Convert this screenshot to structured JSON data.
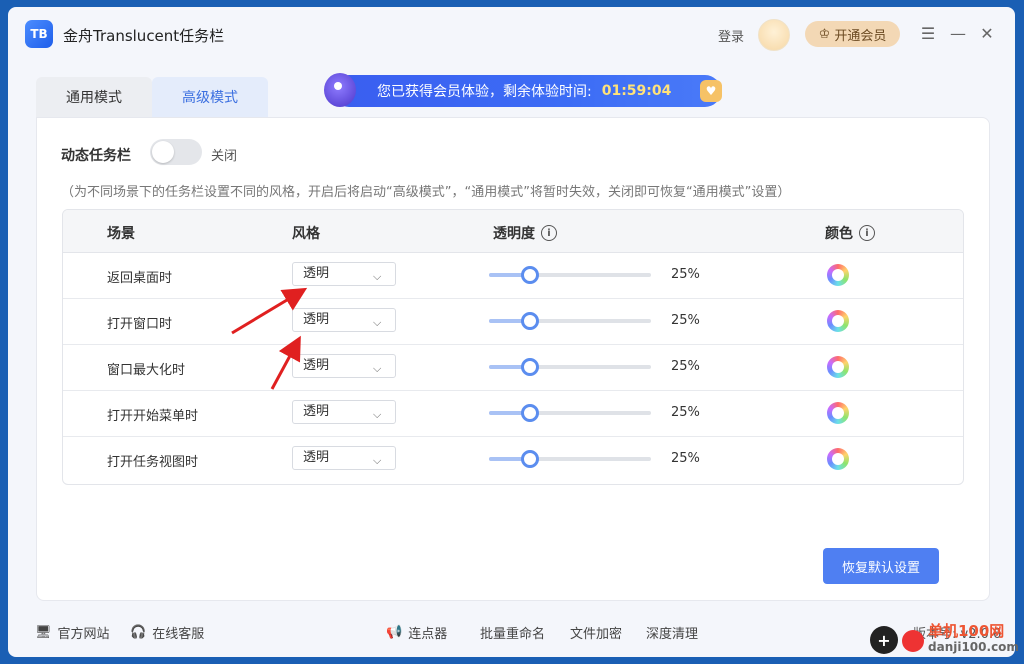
{
  "app": {
    "logo_text": "TB",
    "title": "金舟Translucent任务栏"
  },
  "header": {
    "login_label": "登录",
    "vip_label": "开通会员",
    "vip_icon": "crown-icon"
  },
  "window_controls": {
    "menu": "☰",
    "minimize": "—",
    "close": "✕"
  },
  "tabs": [
    {
      "label": "通用模式"
    },
    {
      "label": "高级模式"
    }
  ],
  "promo": {
    "text": "您已获得会员体验，剩余体验时间:",
    "time": "01:59:04",
    "gift_icon": "gift-icon"
  },
  "dynamic_taskbar": {
    "label": "动态任务栏",
    "state": "关闭"
  },
  "description": "（为不同场景下的任务栏设置不同的风格，开启后将启动“高级模式”，“通用模式”将暂时失效，关闭即可恢复“通用模式”设置）",
  "table": {
    "headers": {
      "scene": "场景",
      "style": "风格",
      "opacity": "透明度",
      "color": "颜色"
    },
    "rows": [
      {
        "scene": "返回桌面时",
        "style": "透明",
        "opacity_value": 25,
        "opacity_label": "25%"
      },
      {
        "scene": "打开窗口时",
        "style": "透明",
        "opacity_value": 25,
        "opacity_label": "25%"
      },
      {
        "scene": "窗口最大化时",
        "style": "透明",
        "opacity_value": 25,
        "opacity_label": "25%"
      },
      {
        "scene": "打开开始菜单时",
        "style": "透明",
        "opacity_value": 25,
        "opacity_label": "25%"
      },
      {
        "scene": "打开任务视图时",
        "style": "透明",
        "opacity_value": 25,
        "opacity_label": "25%"
      }
    ]
  },
  "reset_label": "恢复默认设置",
  "footer": {
    "website": "官方网站",
    "support": "在线客服",
    "clicker": "连点器",
    "rename": "批量重命名",
    "encrypt": "文件加密",
    "clean": "深度清理",
    "version": "版本号: v2.0.6"
  },
  "watermark": {
    "line1": "单机100网",
    "line2": "danji100.com"
  }
}
